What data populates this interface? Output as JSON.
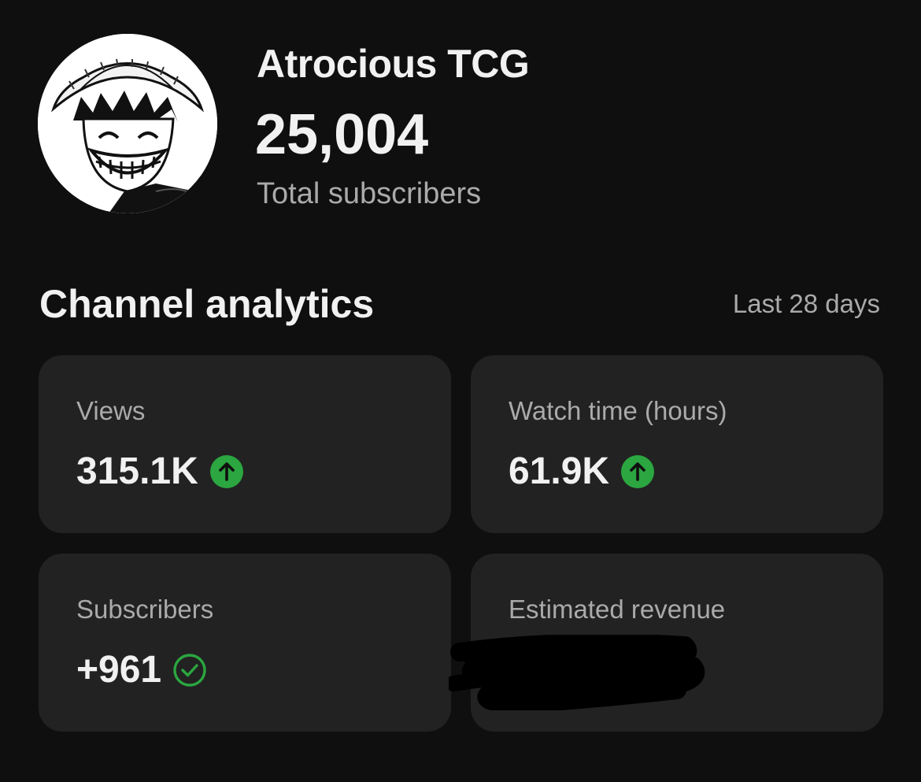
{
  "channel": {
    "name": "Atrocious TCG",
    "subscriber_count": "25,004",
    "subscriber_caption": "Total subscribers",
    "avatar_icon": "avatar-manga-character-icon"
  },
  "analytics": {
    "title": "Channel analytics",
    "period": "Last 28 days",
    "cards": [
      {
        "label": "Views",
        "value": "315.1K",
        "trend_icon": "arrow-up-circle-icon"
      },
      {
        "label": "Watch time (hours)",
        "value": "61.9K",
        "trend_icon": "arrow-up-circle-icon"
      },
      {
        "label": "Subscribers",
        "value": "+961",
        "trend_icon": "check-circle-icon"
      },
      {
        "label": "Estimated revenue",
        "value": "",
        "value_redacted": true
      }
    ]
  },
  "colors": {
    "background": "#0f0f0f",
    "card": "#222222",
    "text_primary": "#f1f1f1",
    "text_secondary": "#aaaaaa",
    "trend_green": "#2ba640"
  }
}
